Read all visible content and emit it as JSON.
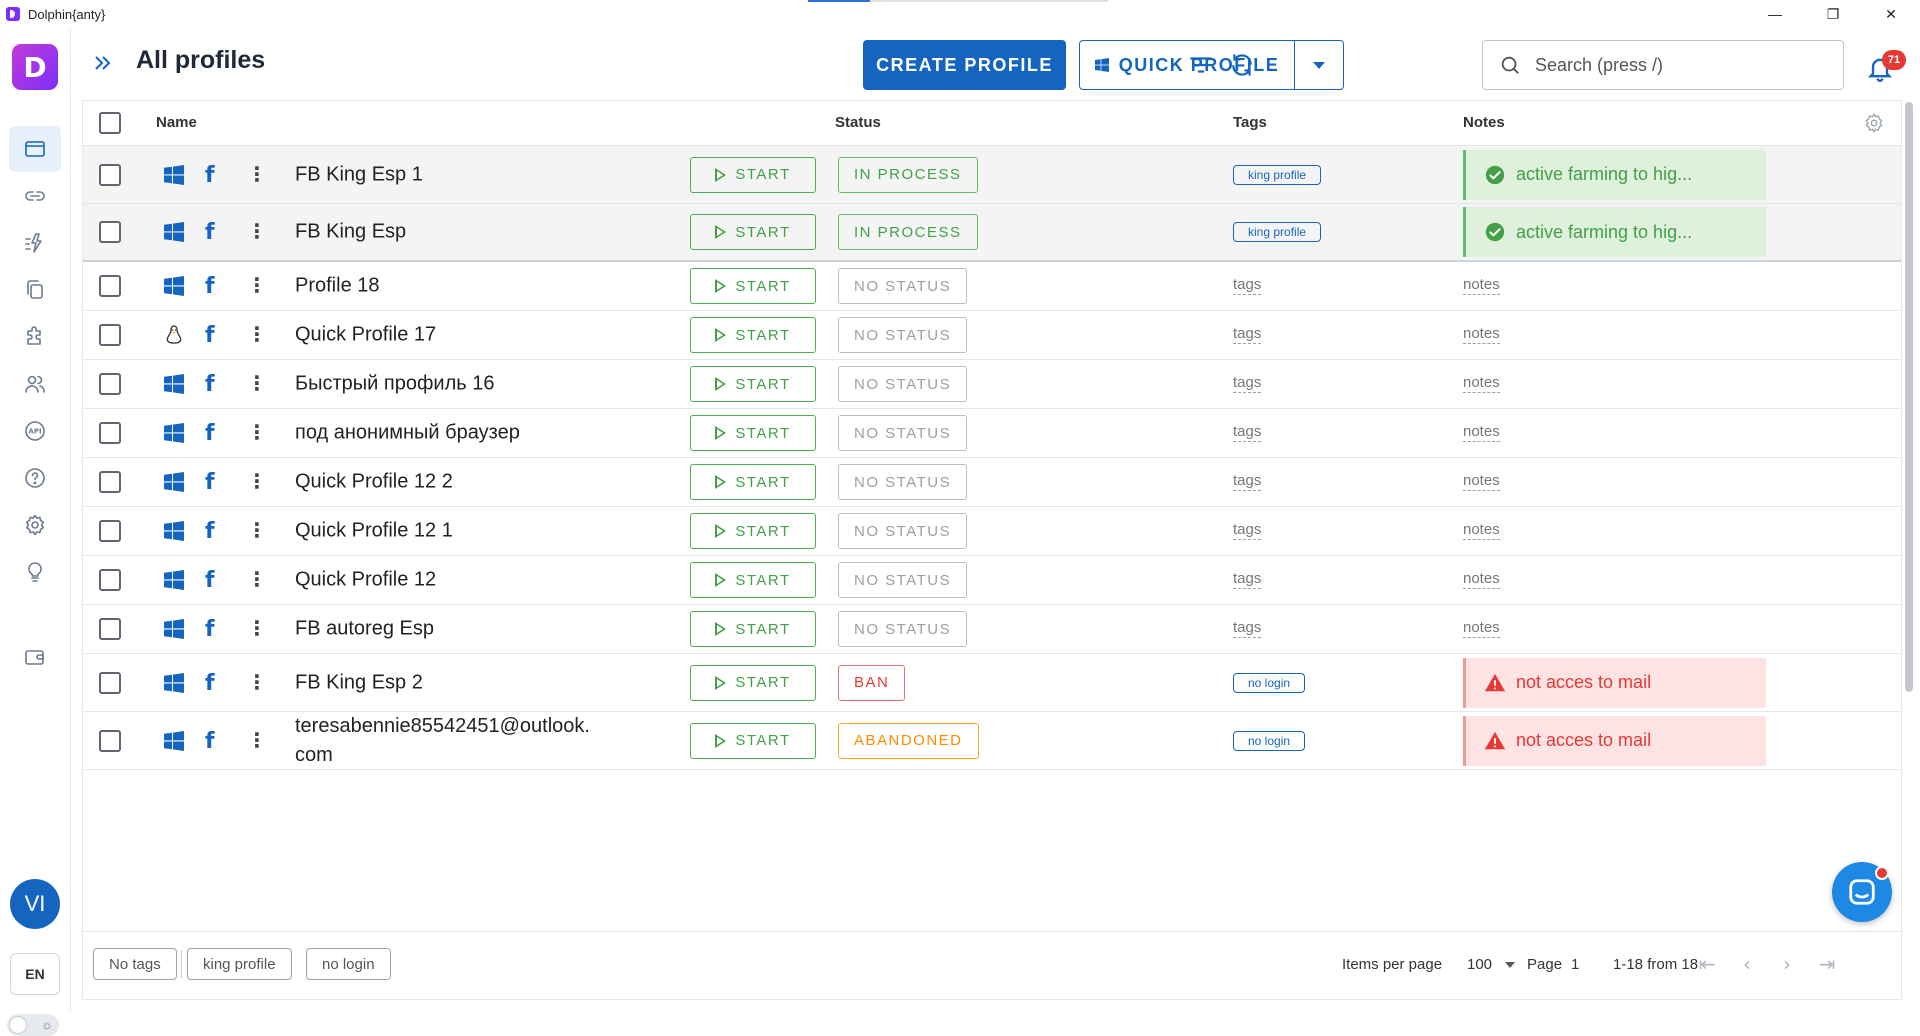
{
  "window": {
    "title": "Dolphin{anty}",
    "minimize": "—",
    "maximize": "❐",
    "close": "✕"
  },
  "sidebar": {
    "logo_letter": "D",
    "avatar_initials": "VI",
    "language": "EN"
  },
  "header": {
    "title": "All profiles",
    "create_button": "CREATE PROFILE",
    "quick_button": "QUICK PROFILE",
    "search_placeholder": "Search (press /)",
    "notifications_count": "71"
  },
  "table": {
    "columns": {
      "name": "Name",
      "status": "Status",
      "tags": "Tags",
      "notes": "Notes"
    },
    "start_label": "START",
    "tag_placeholder": "tags",
    "note_placeholder": "notes",
    "rows": [
      {
        "name": "FB King Esp 1",
        "os": "windows",
        "status": "IN PROCESS",
        "tag": "king profile",
        "note": "active farming to hig..."
      },
      {
        "name": "FB King Esp",
        "os": "windows",
        "status": "IN PROCESS",
        "tag": "king profile",
        "note": "active farming to hig..."
      },
      {
        "name": "Profile 18",
        "os": "windows",
        "status": "NO STATUS"
      },
      {
        "name": "Quick Profile 17",
        "os": "linux",
        "status": "NO STATUS"
      },
      {
        "name": "Быстрый профиль 16",
        "os": "windows",
        "status": "NO STATUS"
      },
      {
        "name": "под анонимный браузер",
        "os": "windows",
        "status": "NO STATUS"
      },
      {
        "name": "Quick Profile 12 2",
        "os": "windows",
        "status": "NO STATUS"
      },
      {
        "name": "Quick Profile 12 1",
        "os": "windows",
        "status": "NO STATUS"
      },
      {
        "name": "Quick Profile 12",
        "os": "windows",
        "status": "NO STATUS"
      },
      {
        "name": "FB autoreg Esp",
        "os": "windows",
        "status": "NO STATUS"
      },
      {
        "name": "FB King Esp 2",
        "os": "windows",
        "status": "BAN",
        "tag": "no login",
        "note": "not acces to mail"
      },
      {
        "name": "teresabennie85542451@outlook.com",
        "os": "windows",
        "status": "ABANDONED",
        "tag": "no login",
        "note": "not acces to mail"
      }
    ]
  },
  "footer": {
    "tag_filters": [
      "No tags",
      "king profile",
      "no login"
    ],
    "items_per_page_label": "Items per page",
    "items_per_page_value": "100",
    "page_label": "Page",
    "page_value": "1",
    "range": "1-18 from 18"
  },
  "colors": {
    "accent": "#1565c0",
    "success": "#43a047",
    "danger": "#e53935",
    "warning": "#fb8c00",
    "muted": "#9e9e9e"
  }
}
